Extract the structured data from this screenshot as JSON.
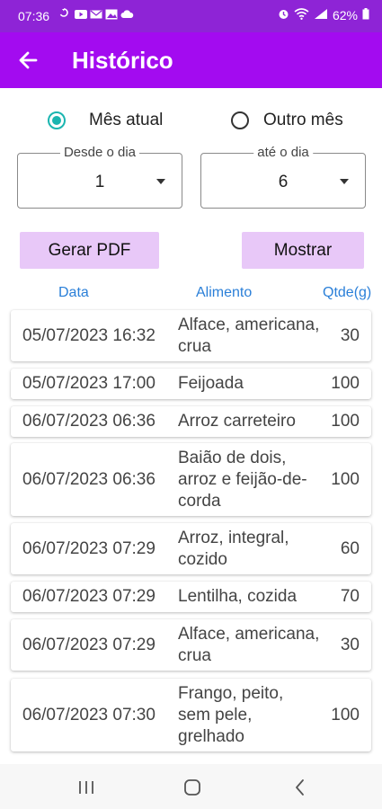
{
  "status_bar": {
    "time": "07:36",
    "battery": "62%"
  },
  "app_bar": {
    "title": "Histórico"
  },
  "filter": {
    "radio_current": "Mês atual",
    "radio_other": "Outro mês",
    "selected": "current",
    "from_label": "Desde o dia",
    "from_value": "1",
    "to_label": "até o dia",
    "to_value": "6"
  },
  "actions": {
    "pdf_label": "Gerar PDF",
    "show_label": "Mostrar"
  },
  "table": {
    "headers": {
      "date": "Data",
      "food": "Alimento",
      "qty": "Qtde(g)"
    },
    "rows": [
      {
        "date": "05/07/2023 16:32",
        "food": "Alface, americana, crua",
        "qty": "30"
      },
      {
        "date": "05/07/2023 17:00",
        "food": "Feijoada",
        "qty": "100"
      },
      {
        "date": "06/07/2023 06:36",
        "food": "Arroz carreteiro",
        "qty": "100"
      },
      {
        "date": "06/07/2023 06:36",
        "food": "Baião de dois, arroz e feijão-de-corda",
        "qty": "100"
      },
      {
        "date": "06/07/2023 07:29",
        "food": "Arroz, integral, cozido",
        "qty": "60"
      },
      {
        "date": "06/07/2023 07:29",
        "food": "Lentilha, cozida",
        "qty": "70"
      },
      {
        "date": "06/07/2023 07:29",
        "food": "Alface, americana, crua",
        "qty": "30"
      },
      {
        "date": "06/07/2023 07:30",
        "food": "Frango, peito, sem pele, grelhado",
        "qty": "100"
      }
    ]
  },
  "colors": {
    "app_bar": "#a30bf0",
    "status_bar": "#8e24d6",
    "radio_accent": "#1ab5b0",
    "button_bg": "#e8c8f8",
    "header_text": "#2a7fd8"
  }
}
